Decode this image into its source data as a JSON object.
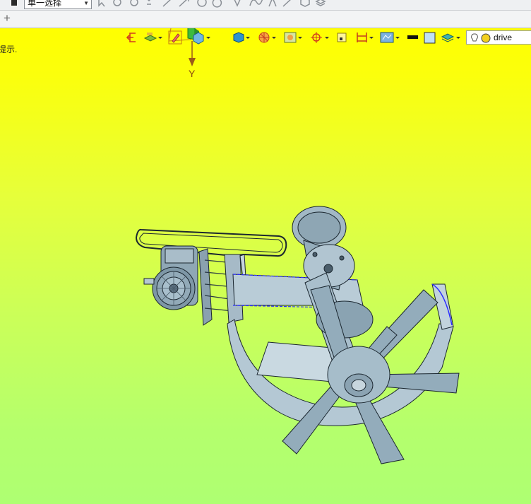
{
  "top_toolbar": {
    "selection_filter_value": "单一选择",
    "tool_icons": [
      "selection-mode-icon",
      "pointer-icon",
      "gear-icon",
      "play-icon",
      "snap-icon",
      "line-icon",
      "arrow-icon",
      "circle-target-icon",
      "rotate-icon",
      "vertex-icon",
      "curve-icon",
      "branch-icon",
      "slash-icon",
      "cube-icon",
      "layers-icon"
    ]
  },
  "tab_bar": {
    "add_tab_label": "+"
  },
  "viewport": {
    "status_hint": "提示.",
    "axis_label": "Y",
    "background_colors": {
      "top": "#ffff00",
      "bottom": "#aeff72"
    },
    "model_color": "#9db4c2",
    "edge_highlight_color": "#2a2cff"
  },
  "view_toolbar": {
    "items": [
      {
        "name": "exit-icon"
      },
      {
        "name": "layer-icon",
        "dropdown": true
      },
      {
        "name": "pencil-icon"
      },
      {
        "name": "shaded-box-icon",
        "dropdown": true
      },
      {
        "name": "blue-cube-icon",
        "dropdown": true
      },
      {
        "name": "sphere-render-icon",
        "dropdown": true
      },
      {
        "name": "image-frame-icon",
        "dropdown": true
      },
      {
        "name": "crosshair-icon",
        "dropdown": true
      },
      {
        "name": "small-box-icon"
      },
      {
        "name": "dimension-icon",
        "dropdown": true
      },
      {
        "name": "network-icon",
        "dropdown": true
      },
      {
        "name": "black-bar-icon"
      },
      {
        "name": "blue-square-icon"
      },
      {
        "name": "teal-layers-icon",
        "dropdown": true
      }
    ],
    "search_value": "drive"
  }
}
